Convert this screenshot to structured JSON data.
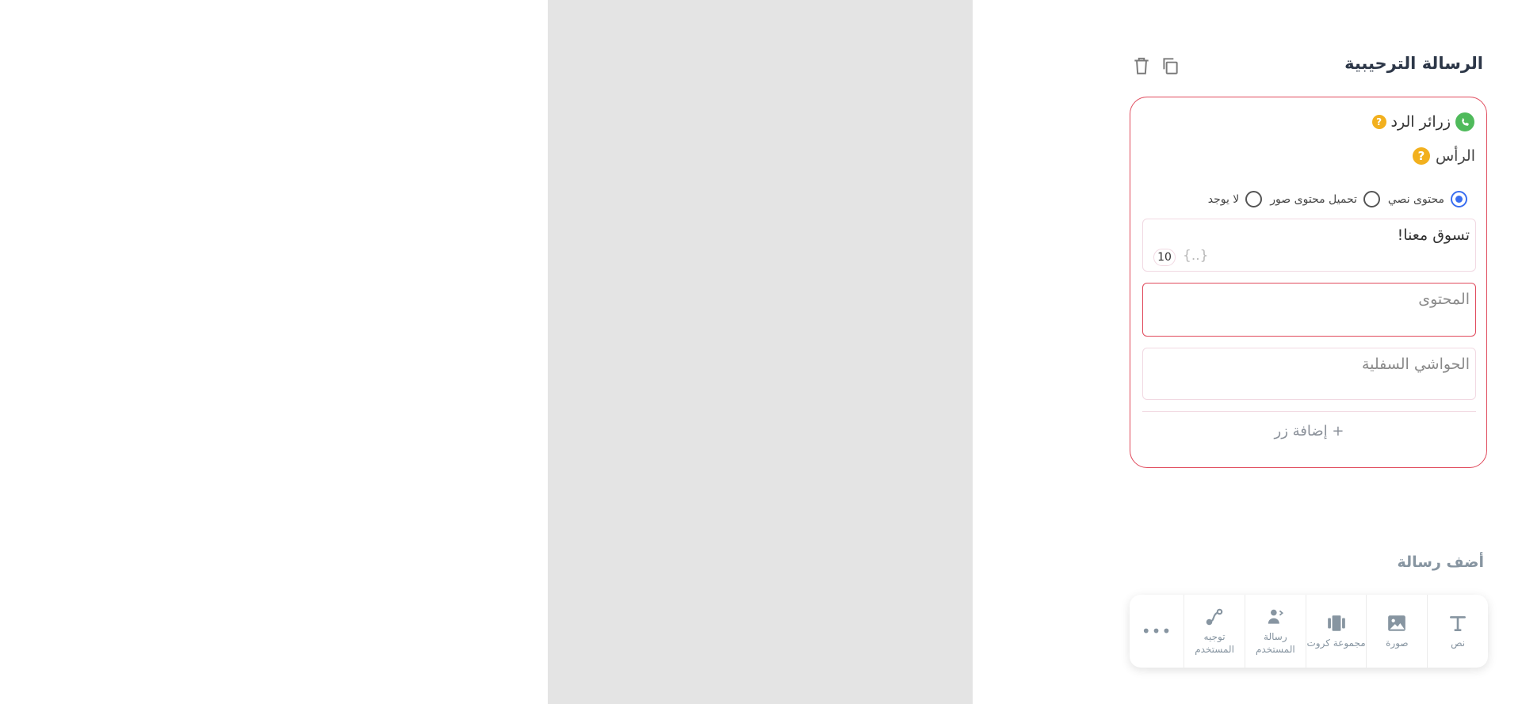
{
  "card": {
    "title": "الرسالة الترحيبية"
  },
  "quick_reply": {
    "label": "زرائر الرد",
    "help": "?"
  },
  "header_section": {
    "label": "الرأس",
    "help": "?"
  },
  "radio_options": [
    {
      "label": "محتوى نصي",
      "checked": true
    },
    {
      "label": "تحميل محتوى صور",
      "checked": false
    },
    {
      "label": "لا يوجد",
      "checked": false
    }
  ],
  "header_field": {
    "value": "تسوق معنا!",
    "var_button": "{..}",
    "counter": "10"
  },
  "content_field": {
    "placeholder": "المحتوى"
  },
  "footer_field": {
    "placeholder": "الحواشي السفلية"
  },
  "add_button": {
    "label": "+ إضافة زر"
  },
  "add_message": {
    "title": "أضف رسالة"
  },
  "toolbar": {
    "items": [
      {
        "label": "نص",
        "icon": "text-icon"
      },
      {
        "label": "صورة",
        "icon": "image-icon"
      },
      {
        "label": "مجموعة كروت",
        "icon": "carousel-icon"
      },
      {
        "label": "رسالة المستخدم",
        "icon": "user-message-icon"
      },
      {
        "label": "توجيه المستخدم",
        "icon": "route-icon"
      }
    ],
    "more": "•••"
  },
  "colors": {
    "accent_red": "#e04a5c",
    "radio_blue": "#3a6ef0",
    "whatsapp_green": "#4fba5b",
    "help_yellow": "#f2b01e"
  }
}
